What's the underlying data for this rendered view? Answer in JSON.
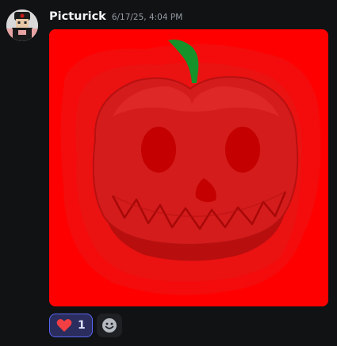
{
  "message": {
    "author": "Picturick",
    "timestamp": "6/17/25, 4:04 PM",
    "avatar_icon": "roblox-avatar",
    "attachment": {
      "type": "image",
      "depicts": "red-pumpkin-jack-o-lantern-drawing",
      "colors": {
        "background": "#ff0000",
        "pumpkin": "#d41c1c",
        "face": "#c40000",
        "stem": "#16922a"
      }
    },
    "reactions": [
      {
        "emoji_icon": "heart-icon",
        "emoji_color": "#f23f43",
        "count": "1",
        "selected": true
      }
    ],
    "add_reaction_icon": "smile-icon"
  }
}
